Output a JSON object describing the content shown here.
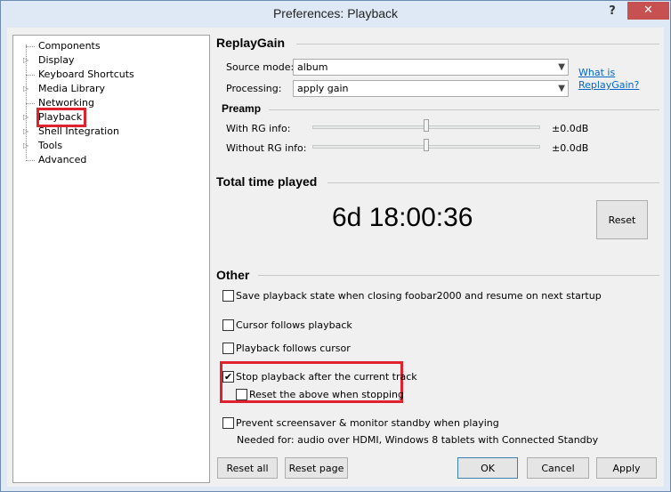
{
  "window": {
    "title": "Preferences: Playback",
    "help": "?",
    "close": "✕"
  },
  "tree": {
    "items": [
      {
        "label": "Components",
        "expandable": false
      },
      {
        "label": "Display",
        "expandable": true
      },
      {
        "label": "Keyboard Shortcuts",
        "expandable": false
      },
      {
        "label": "Media Library",
        "expandable": true
      },
      {
        "label": "Networking",
        "expandable": false
      },
      {
        "label": "Playback",
        "expandable": true,
        "selected": true
      },
      {
        "label": "Shell Integration",
        "expandable": true
      },
      {
        "label": "Tools",
        "expandable": true
      },
      {
        "label": "Advanced",
        "expandable": false
      }
    ]
  },
  "replaygain": {
    "title": "ReplayGain",
    "source_mode_label": "Source mode:",
    "source_mode_value": "album",
    "processing_label": "Processing:",
    "processing_value": "apply gain",
    "link": "What is ReplayGain?"
  },
  "preamp": {
    "title": "Preamp",
    "with_rg_label": "With RG info:",
    "with_rg_value": "±0.0dB",
    "without_rg_label": "Without RG info:",
    "without_rg_value": "±0.0dB"
  },
  "total_time": {
    "title": "Total time played",
    "value": "6d 18:00:36",
    "reset_label": "Reset"
  },
  "other": {
    "title": "Other",
    "options": [
      {
        "label": "Save playback state when closing foobar2000 and resume on next startup",
        "checked": false
      },
      {
        "label": "Cursor follows playback",
        "checked": false
      },
      {
        "label": "Playback follows cursor",
        "checked": false
      },
      {
        "label": "Stop playback after the current track",
        "checked": true
      },
      {
        "label": "Reset the above when stopping",
        "checked": false
      },
      {
        "label": "Prevent screensaver & monitor standby when playing",
        "checked": false
      }
    ],
    "note": "Needed for: audio over HDMI, Windows 8 tablets with Connected Standby"
  },
  "buttons": {
    "reset_all": "Reset all",
    "reset_page": "Reset page",
    "ok": "OK",
    "cancel": "Cancel",
    "apply": "Apply"
  },
  "checkmark": "✔",
  "colors": {
    "highlight": "#e0222f",
    "link": "#0066cc"
  }
}
